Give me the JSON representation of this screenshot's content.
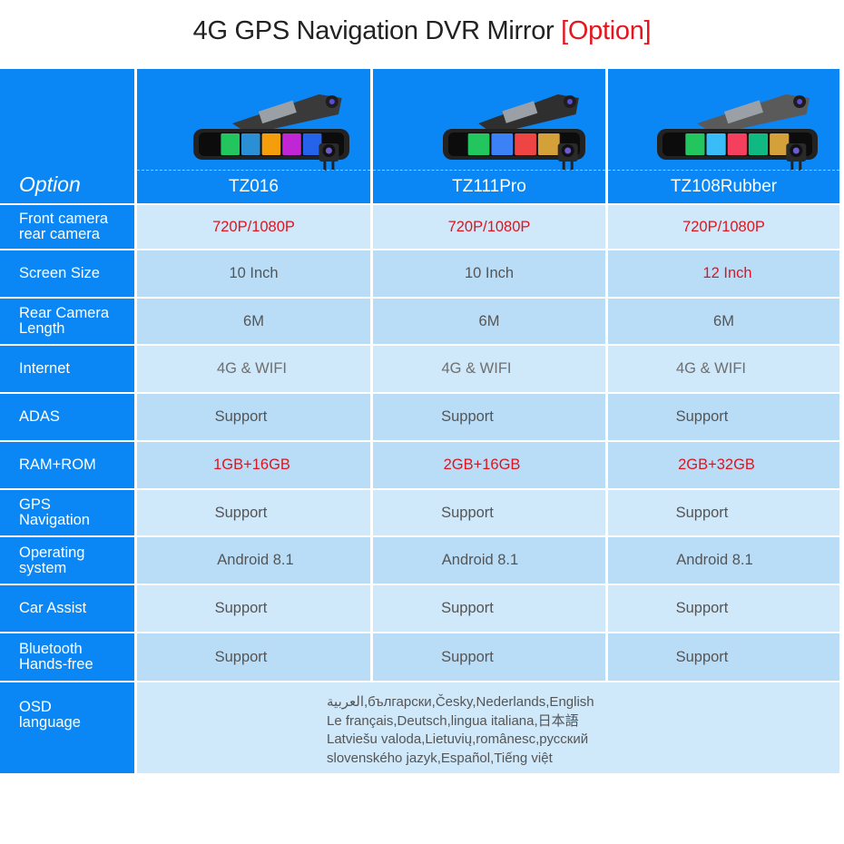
{
  "title": {
    "main": "4G GPS Navigation DVR Mirror",
    "accent": "[Option]"
  },
  "colors": {
    "header_blue": "#0a86f5",
    "row_light": "#cfe8fa",
    "row_dark": "#b9ddf7",
    "highlight_red": "#e0141e",
    "value_gray": "#555555"
  },
  "header": {
    "label": "Option",
    "products": [
      {
        "name": "TZ016",
        "image": "mirror-dashcam-image"
      },
      {
        "name": "TZ111Pro",
        "image": "mirror-dashcam-image"
      },
      {
        "name": "TZ108Rubber",
        "image": "mirror-dashcam-image"
      }
    ]
  },
  "rows": [
    {
      "label": [
        "Front camera",
        "rear camera"
      ],
      "values": [
        "720P/1080P",
        "720P/1080P",
        "720P/1080P"
      ],
      "highlight": [
        true,
        true,
        true
      ]
    },
    {
      "label": [
        "Screen Size"
      ],
      "values": [
        "10 Inch",
        "10 Inch",
        "12 Inch"
      ],
      "highlight": [
        false,
        false,
        true
      ]
    },
    {
      "label": [
        "Rear Camera",
        "Length"
      ],
      "values": [
        "6M",
        "6M",
        "6M"
      ],
      "highlight": [
        false,
        false,
        false
      ]
    },
    {
      "label": [
        "Internet"
      ],
      "values": [
        "4G & WIFI",
        "4G & WIFI",
        "4G & WIFI"
      ],
      "highlight": [
        false,
        false,
        false
      ]
    },
    {
      "label": [
        "ADAS"
      ],
      "values": [
        "Support",
        "Support",
        "Support"
      ],
      "highlight": [
        false,
        false,
        false
      ]
    },
    {
      "label": [
        "RAM+ROM"
      ],
      "values": [
        "1GB+16GB",
        "2GB+16GB",
        "2GB+32GB"
      ],
      "highlight": [
        true,
        true,
        true
      ]
    },
    {
      "label": [
        "GPS",
        "Navigation"
      ],
      "values": [
        "Support",
        "Support",
        "Support"
      ],
      "highlight": [
        false,
        false,
        false
      ]
    },
    {
      "label": [
        "Operating",
        "system"
      ],
      "values": [
        "Android 8.1",
        "Android 8.1",
        "Android 8.1"
      ],
      "highlight": [
        false,
        false,
        false
      ]
    },
    {
      "label": [
        "Car Assist"
      ],
      "values": [
        "Support",
        "Support",
        "Support"
      ],
      "highlight": [
        false,
        false,
        false
      ]
    },
    {
      "label": [
        "Bluetooth",
        "Hands-free"
      ],
      "values": [
        "Support",
        "Support",
        "Support"
      ],
      "highlight": [
        false,
        false,
        false
      ]
    }
  ],
  "osd": {
    "label": [
      "OSD",
      "language"
    ],
    "lines": [
      "العربية,български,Česky,Nederlands,English",
      "Le français,Deutsch,lingua italiana,日本語",
      "Latviešu valoda,Lietuvių,românesc,русский",
      "slovenského jazyk,Español,Tiếng việt"
    ]
  }
}
